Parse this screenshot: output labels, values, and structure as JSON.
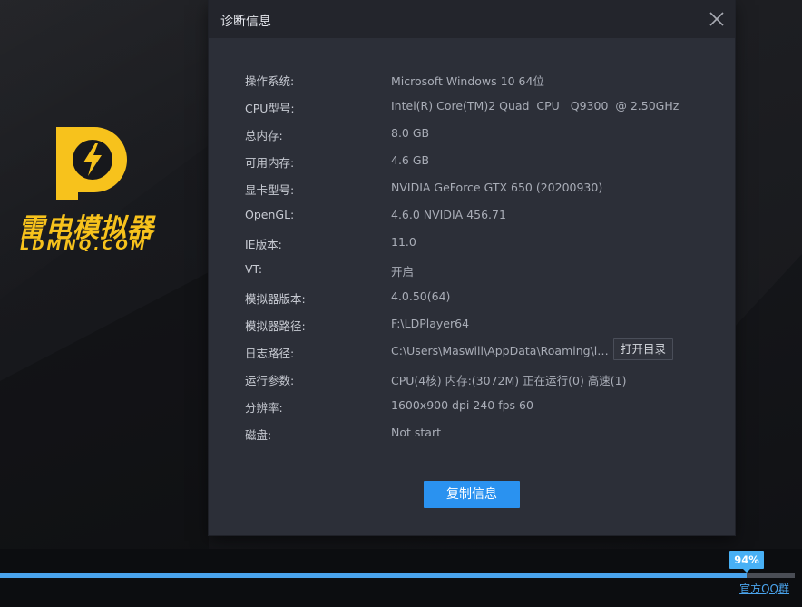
{
  "brand": {
    "name_cn": "雷电模拟器",
    "name_en": "LDMNQ.COM",
    "accent_color": "#f7c21c",
    "logo_icon": "lightning-bolt-icon"
  },
  "dialog": {
    "title": "诊断信息",
    "close_icon": "close-icon",
    "rows": [
      {
        "label": "操作系统:",
        "value": "Microsoft Windows 10 64位"
      },
      {
        "label": "CPU型号:",
        "value": "Intel(R) Core(TM)2 Quad  CPU   Q9300  @ 2.50GHz"
      },
      {
        "label": "总内存:",
        "value": "8.0 GB"
      },
      {
        "label": "可用内存:",
        "value": "4.6 GB"
      },
      {
        "label": "显卡型号:",
        "value": "NVIDIA GeForce GTX 650 (20200930)"
      },
      {
        "label": "OpenGL:",
        "value": "4.6.0 NVIDIA 456.71"
      },
      {
        "label": "IE版本:",
        "value": "11.0"
      },
      {
        "label": "VT:",
        "value": "开启"
      },
      {
        "label": "模拟器版本:",
        "value": "4.0.50(64)"
      },
      {
        "label": "模拟器路径:",
        "value": "F:\\LDPlayer64"
      },
      {
        "label": "日志路径:",
        "value": "C:\\Users\\Maswill\\AppData\\Roaming\\leidian"
      },
      {
        "label": "运行参数:",
        "value": "CPU(4核) 内存:(3072M) 正在运行(0) 高速(1)"
      },
      {
        "label": "分辨率:",
        "value": "1600x900 dpi 240 fps 60"
      },
      {
        "label": "磁盘:",
        "value": "Not start"
      }
    ],
    "open_dir_label": "打开目录",
    "copy_label": "复制信息",
    "copy_button_color": "#2a92f0"
  },
  "progress": {
    "percent": 94,
    "percent_label": "94%",
    "fill_color": "#4aa3ec"
  },
  "footer": {
    "qq_group_link": "官方QQ群"
  }
}
